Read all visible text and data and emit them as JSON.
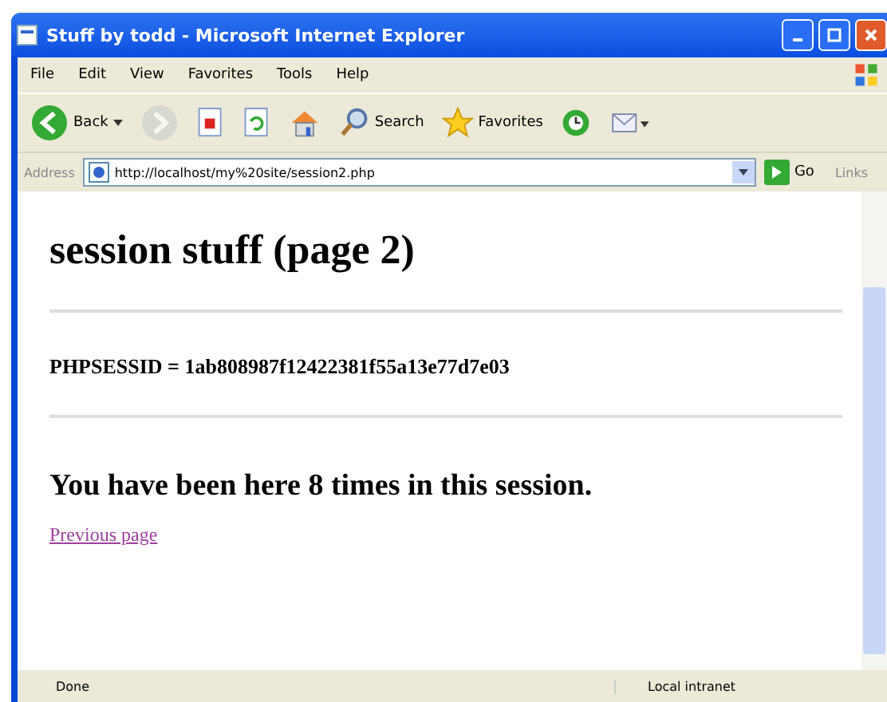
{
  "window": {
    "title": "Stuff by todd - Microsoft Internet Explorer"
  },
  "menu": [
    "File",
    "Edit",
    "View",
    "Favorites",
    "Tools",
    "Help"
  ],
  "toolbar": [
    {
      "kind": "back",
      "label": "Back",
      "disabled": false
    },
    {
      "kind": "forward",
      "disabled": true
    },
    {
      "kind": "stop",
      "disabled": false
    },
    {
      "kind": "refresh",
      "disabled": false
    },
    {
      "kind": "home",
      "disabled": false
    },
    {
      "kind": "search",
      "label": "Search",
      "disabled": false
    },
    {
      "kind": "favorites",
      "label": "Favorites",
      "disabled": false
    },
    {
      "kind": "history",
      "disabled": false
    },
    {
      "kind": "mail",
      "disabled": false
    }
  ],
  "address_bar": {
    "label": "Address",
    "value": "http://localhost/my%20site/session2.php",
    "go": "Go",
    "links": "Links"
  },
  "page": {
    "heading": "session stuff (page 2)",
    "session_line": "PHPSESSID = 1ab808987f12422381f55a13e77d7e03",
    "visits": "You have been here 8 times in this session.",
    "link": "Previous page"
  },
  "status_bar": {
    "text": "Done",
    "zone": "Local intranet"
  }
}
